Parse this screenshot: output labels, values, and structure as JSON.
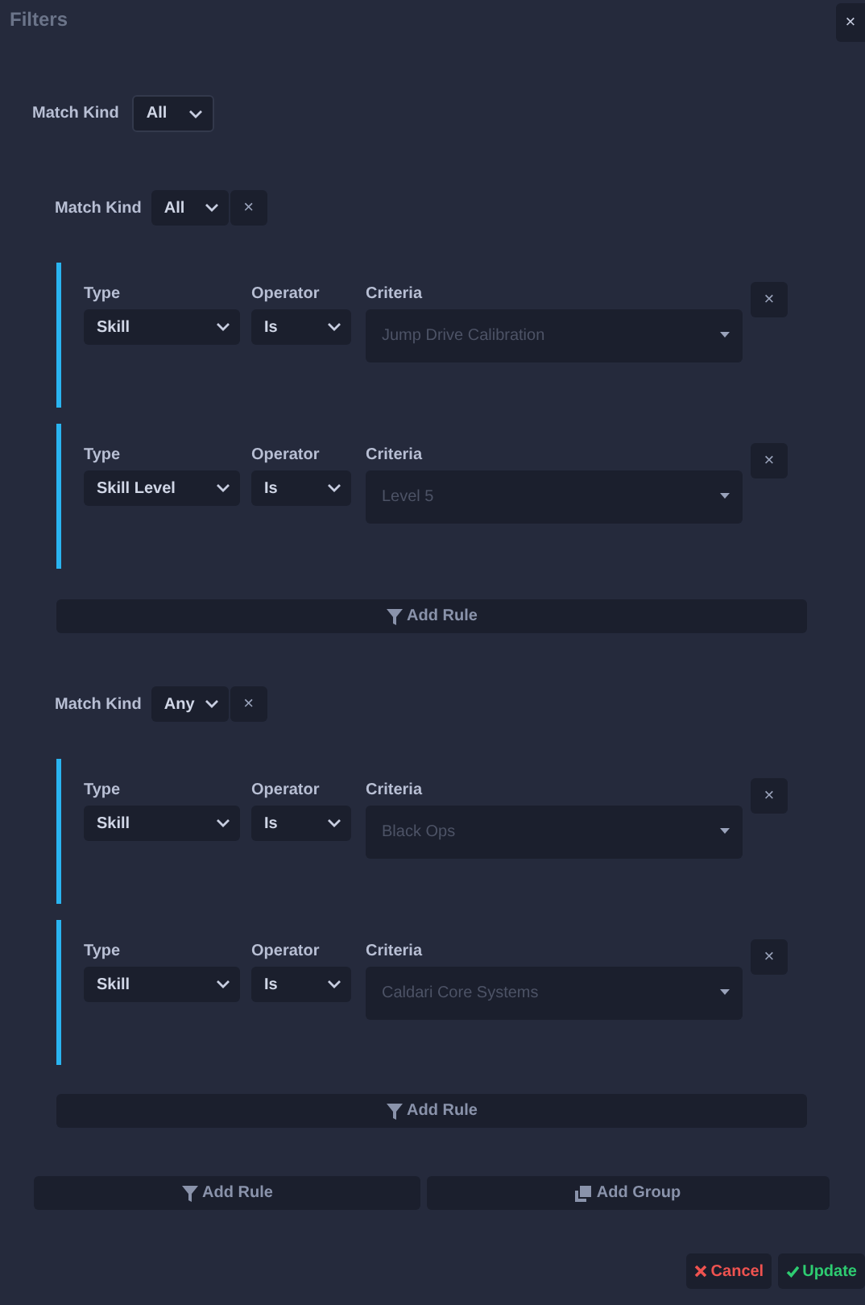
{
  "title": "Filters",
  "close": "×",
  "match_kind": {
    "label": "Match Kind",
    "value": "All"
  },
  "groups": [
    {
      "match_kind_label": "Match Kind",
      "match_kind": "All",
      "remove": "×",
      "add_rule": "Add Rule",
      "rules": [
        {
          "type_label": "Type",
          "type": "Skill",
          "operator_label": "Operator",
          "operator": "Is",
          "criteria_label": "Criteria",
          "criteria_placeholder": "Jump Drive Calibration",
          "remove": "×"
        },
        {
          "type_label": "Type",
          "type": "Skill Level",
          "operator_label": "Operator",
          "operator": "Is",
          "criteria_label": "Criteria",
          "criteria_placeholder": "Level 5",
          "remove": "×"
        }
      ]
    },
    {
      "match_kind_label": "Match Kind",
      "match_kind": "Any",
      "remove": "×",
      "add_rule": "Add Rule",
      "rules": [
        {
          "type_label": "Type",
          "type": "Skill",
          "operator_label": "Operator",
          "operator": "Is",
          "criteria_label": "Criteria",
          "criteria_placeholder": "Black Ops",
          "remove": "×"
        },
        {
          "type_label": "Type",
          "type": "Skill",
          "operator_label": "Operator",
          "operator": "Is",
          "criteria_label": "Criteria",
          "criteria_placeholder": "Caldari Core Systems",
          "remove": "×"
        }
      ]
    }
  ],
  "footer": {
    "add_rule": "Add Rule",
    "add_group": "Add Group"
  },
  "actions": [
    {
      "kind": "cancel",
      "label": "Cancel"
    },
    {
      "kind": "update",
      "label": "Update"
    }
  ]
}
